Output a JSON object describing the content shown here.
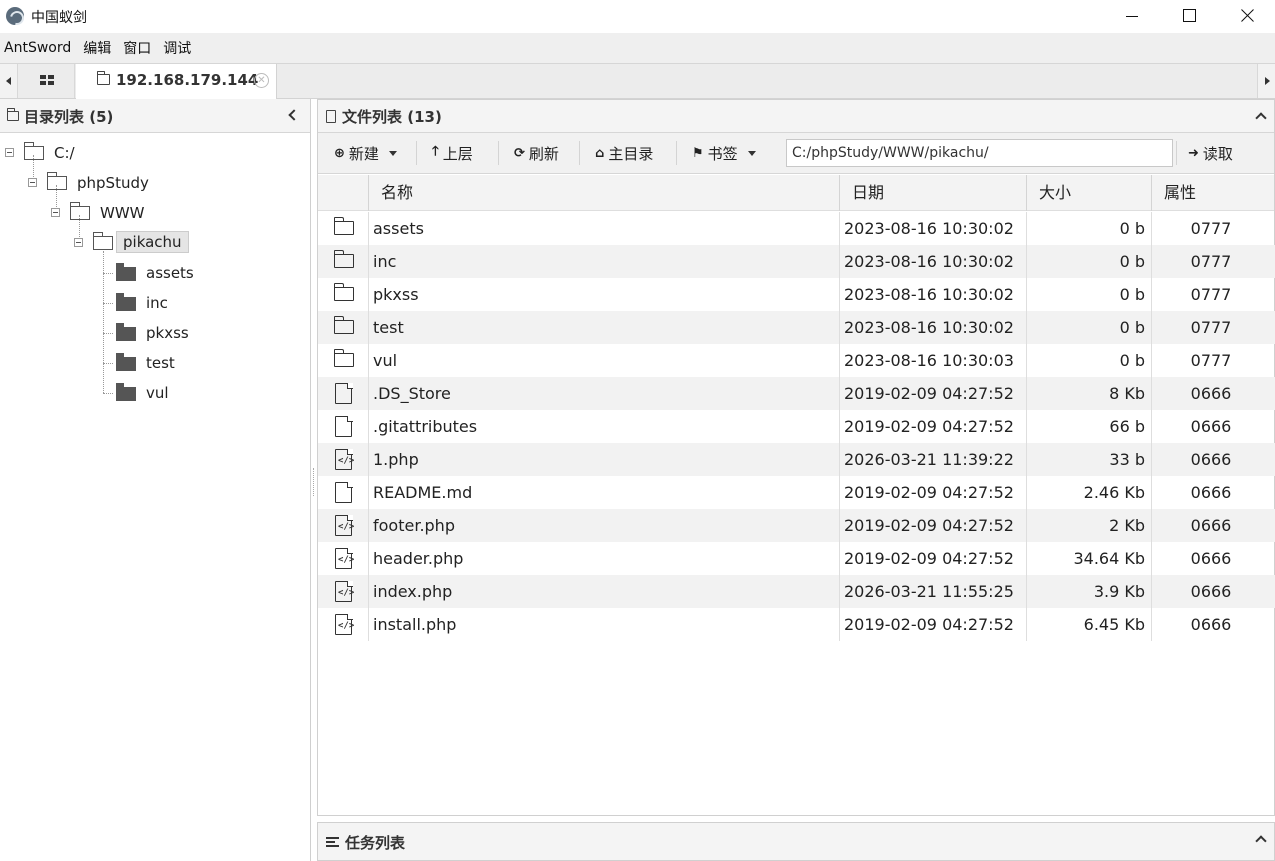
{
  "window": {
    "title": "中国蚁剑"
  },
  "menu": [
    "AntSword",
    "编辑",
    "窗口",
    "调试"
  ],
  "tabs": {
    "active_label": "192.168.179.144",
    "close_glyph": "✕"
  },
  "left_panel": {
    "title": "目录列表 (5)",
    "tree": [
      {
        "label": "C:/"
      },
      {
        "label": "phpStudy"
      },
      {
        "label": "WWW"
      },
      {
        "label": "pikachu",
        "selected": true
      },
      {
        "label": "assets"
      },
      {
        "label": "inc"
      },
      {
        "label": "pkxss"
      },
      {
        "label": "test"
      },
      {
        "label": "vul"
      }
    ]
  },
  "right_panel": {
    "title": "文件列表 (13)",
    "toolbar": {
      "new_label": "新建",
      "up_label": "上层",
      "refresh_label": "刷新",
      "home_label": "主目录",
      "bookmark_label": "书签",
      "path_value": "C:/phpStudy/WWW/pikachu/",
      "read_label": "读取"
    },
    "columns": [
      "名称",
      "日期",
      "大小",
      "属性"
    ],
    "files": [
      {
        "type": "folder",
        "name": "assets",
        "date": "2023-08-16 10:30:02",
        "size": "0 b",
        "attr": "0777"
      },
      {
        "type": "folder",
        "name": "inc",
        "date": "2023-08-16 10:30:02",
        "size": "0 b",
        "attr": "0777"
      },
      {
        "type": "folder",
        "name": "pkxss",
        "date": "2023-08-16 10:30:02",
        "size": "0 b",
        "attr": "0777"
      },
      {
        "type": "folder",
        "name": "test",
        "date": "2023-08-16 10:30:02",
        "size": "0 b",
        "attr": "0777"
      },
      {
        "type": "folder",
        "name": "vul",
        "date": "2023-08-16 10:30:03",
        "size": "0 b",
        "attr": "0777"
      },
      {
        "type": "file",
        "name": ".DS_Store",
        "date": "2019-02-09 04:27:52",
        "size": "8 Kb",
        "attr": "0666"
      },
      {
        "type": "file",
        "name": ".gitattributes",
        "date": "2019-02-09 04:27:52",
        "size": "66 b",
        "attr": "0666"
      },
      {
        "type": "code",
        "name": "1.php",
        "date": "2026-03-21 11:39:22",
        "size": "33 b",
        "attr": "0666"
      },
      {
        "type": "file",
        "name": "README.md",
        "date": "2019-02-09 04:27:52",
        "size": "2.46 Kb",
        "attr": "0666"
      },
      {
        "type": "code",
        "name": "footer.php",
        "date": "2019-02-09 04:27:52",
        "size": "2 Kb",
        "attr": "0666"
      },
      {
        "type": "code",
        "name": "header.php",
        "date": "2019-02-09 04:27:52",
        "size": "34.64 Kb",
        "attr": "0666"
      },
      {
        "type": "code",
        "name": "index.php",
        "date": "2026-03-21 11:55:25",
        "size": "3.9 Kb",
        "attr": "0666"
      },
      {
        "type": "code",
        "name": "install.php",
        "date": "2019-02-09 04:27:52",
        "size": "6.45 Kb",
        "attr": "0666"
      }
    ]
  },
  "task_panel": {
    "title": "任务列表"
  }
}
